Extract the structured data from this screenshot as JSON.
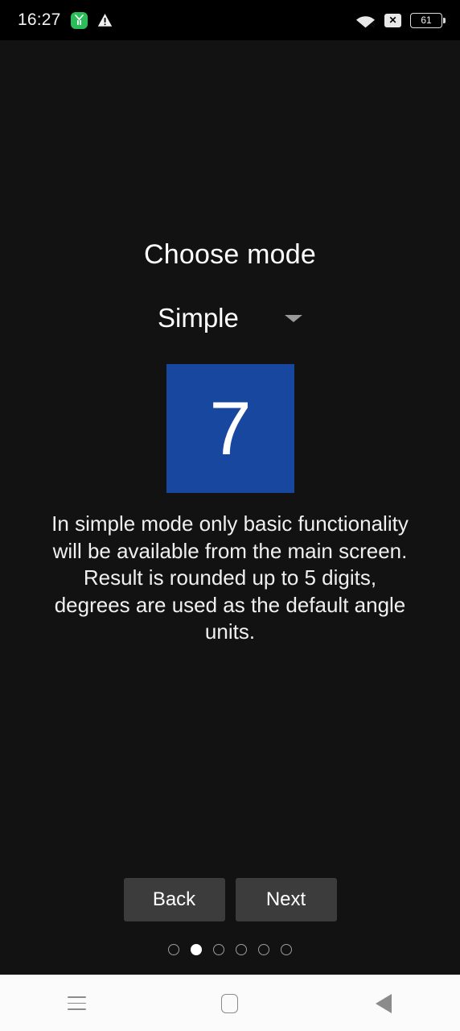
{
  "status_bar": {
    "time": "16:27",
    "battery_level": "61",
    "icons": {
      "app_notification": "green-app-icon",
      "warning": "warning-triangle-icon",
      "wifi": "wifi-icon",
      "no_sim": "x-icon",
      "battery": "battery-icon"
    }
  },
  "main": {
    "title": "Choose mode",
    "mode_dropdown": {
      "selected": "Simple",
      "chevron": "chevron-down-icon"
    },
    "preview": {
      "digit": "7",
      "color": "#17479e"
    },
    "description": "In simple mode only basic functionality will be available from the main screen. Result is rounded up to 5 digits, degrees are used as the default angle units."
  },
  "footer": {
    "back_label": "Back",
    "next_label": "Next",
    "page_indicator": {
      "total": 6,
      "active_index": 1
    }
  },
  "system_nav": {
    "recents": "menu-icon",
    "home": "home-icon",
    "back": "back-icon"
  }
}
